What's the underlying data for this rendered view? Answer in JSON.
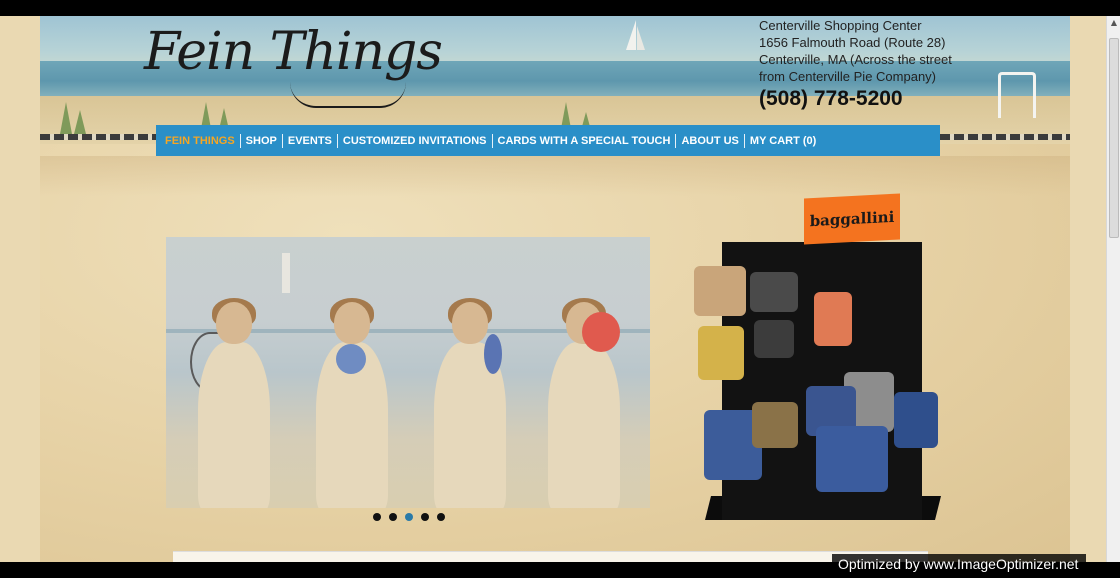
{
  "header": {
    "logo_text": "Fein Things",
    "address_lines": [
      "Centerville Shopping Center",
      "1656 Falmouth Road (Route 28)",
      "Centerville, MA (Across the street",
      "from Centerville Pie Company)"
    ],
    "phone": "(508) 778-5200"
  },
  "nav": {
    "items": [
      {
        "label": "FEIN THINGS"
      },
      {
        "label": "SHOP"
      },
      {
        "label": "EVENTS"
      },
      {
        "label": "CUSTOMIZED INVITATIONS"
      },
      {
        "label": "CARDS WITH A SPECIAL TOUCH"
      },
      {
        "label": "ABOUT US"
      },
      {
        "label": "MY CART (0)"
      }
    ],
    "active_color": "#f5a623",
    "bar_color": "#2a8fc8"
  },
  "slideshow": {
    "slide_count": 5,
    "active_slide": 3
  },
  "promo": {
    "brand_label": "baggallini",
    "brand_color": "#f4731f"
  },
  "watermark": {
    "text": "Optimized by www.ImageOptimizer.net"
  }
}
